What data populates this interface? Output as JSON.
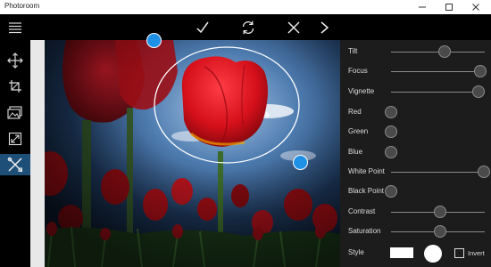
{
  "window": {
    "title": "Photoroom",
    "controls": [
      "minimize-icon",
      "maximize-icon",
      "close-icon"
    ]
  },
  "command_bar": {
    "menu_icon": "hamburger-menu-icon",
    "actions": [
      "checkmark-icon",
      "refresh-icon",
      "close-icon",
      "chevron-right-icon"
    ]
  },
  "tools": [
    {
      "name": "move-icon",
      "active": false
    },
    {
      "name": "crop-icon",
      "active": false
    },
    {
      "name": "image-icon",
      "active": false
    },
    {
      "name": "resize-icon",
      "active": false
    },
    {
      "name": "tools-icon",
      "active": true
    }
  ],
  "adjustments": [
    {
      "label": "Tilt",
      "value": 0.57
    },
    {
      "label": "Focus",
      "value": 0.95
    },
    {
      "label": "Vignette",
      "value": 0.93
    },
    {
      "label": "Red",
      "value": 0.0
    },
    {
      "label": "Green",
      "value": 0.0
    },
    {
      "label": "Blue",
      "value": 0.0
    },
    {
      "label": "White Point",
      "value": 1.0
    },
    {
      "label": "Black Point",
      "value": 0.0
    },
    {
      "label": "Contrast",
      "value": 0.52
    },
    {
      "label": "Saturation",
      "value": 0.52
    }
  ],
  "style": {
    "label": "Style",
    "invert_label": "Invert",
    "invert_checked": false
  },
  "colors": {
    "accent": "#1e90e6",
    "active_tool": "#1e4f78",
    "panel": "#1c1c1c"
  }
}
